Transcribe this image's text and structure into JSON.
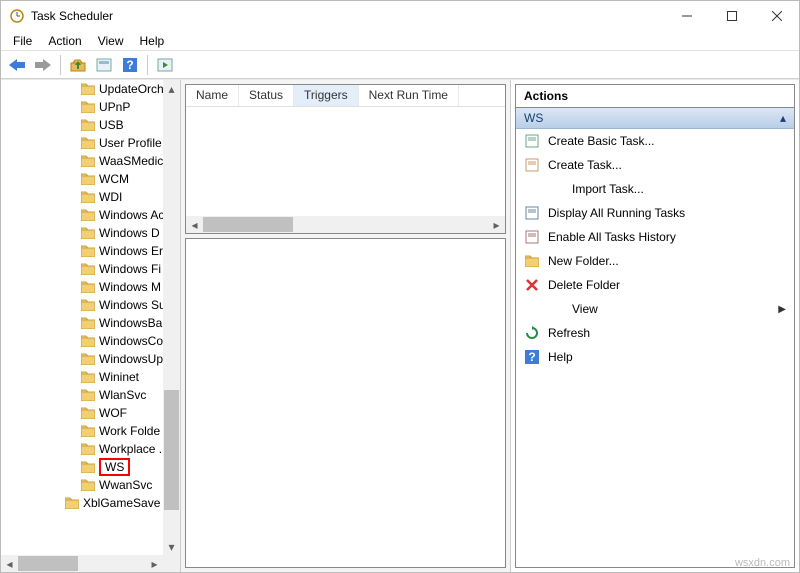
{
  "window": {
    "title": "Task Scheduler"
  },
  "menubar": [
    "File",
    "Action",
    "View",
    "Help"
  ],
  "tree": [
    {
      "label": "UpdateOrch",
      "level": 1
    },
    {
      "label": "UPnP",
      "level": 1
    },
    {
      "label": "USB",
      "level": 1
    },
    {
      "label": "User Profile",
      "level": 1
    },
    {
      "label": "WaaSMedic",
      "level": 1
    },
    {
      "label": "WCM",
      "level": 1
    },
    {
      "label": "WDI",
      "level": 1
    },
    {
      "label": "Windows Ac",
      "level": 1
    },
    {
      "label": "Windows D",
      "level": 1
    },
    {
      "label": "Windows Er",
      "level": 1
    },
    {
      "label": "Windows Fi",
      "level": 1
    },
    {
      "label": "Windows M",
      "level": 1
    },
    {
      "label": "Windows Su",
      "level": 1
    },
    {
      "label": "WindowsBa",
      "level": 1
    },
    {
      "label": "WindowsCo",
      "level": 1
    },
    {
      "label": "WindowsUp",
      "level": 1
    },
    {
      "label": "Wininet",
      "level": 1
    },
    {
      "label": "WlanSvc",
      "level": 1
    },
    {
      "label": "WOF",
      "level": 1
    },
    {
      "label": "Work Folde",
      "level": 1
    },
    {
      "label": "Workplace .",
      "level": 1
    },
    {
      "label": "WS",
      "level": 1,
      "selected": true
    },
    {
      "label": "WwanSvc",
      "level": 1
    },
    {
      "label": "XblGameSave",
      "level": 2
    }
  ],
  "columns": [
    {
      "label": "Name",
      "selected": false
    },
    {
      "label": "Status",
      "selected": false
    },
    {
      "label": "Triggers",
      "selected": true
    },
    {
      "label": "Next Run Time",
      "selected": false
    }
  ],
  "actions": {
    "header": "Actions",
    "section": "WS",
    "items": [
      {
        "icon": "create-basic-icon",
        "label": "Create Basic Task...",
        "color": "#6a8"
      },
      {
        "icon": "create-task-icon",
        "label": "Create Task...",
        "color": "#c96"
      },
      {
        "icon": "import-icon",
        "label": "Import Task...",
        "indent": true
      },
      {
        "icon": "display-running-icon",
        "label": "Display All Running Tasks",
        "color": "#68a"
      },
      {
        "icon": "enable-history-icon",
        "label": "Enable All Tasks History",
        "color": "#a77"
      },
      {
        "icon": "new-folder-icon",
        "label": "New Folder...",
        "color": "#e9b95a"
      },
      {
        "icon": "delete-folder-icon",
        "label": "Delete Folder",
        "color": "#d33",
        "bold": true
      },
      {
        "icon": "view-icon",
        "label": "View",
        "indent": true,
        "submenu": true
      },
      {
        "icon": "refresh-icon",
        "label": "Refresh",
        "color": "#2a8"
      },
      {
        "icon": "help-icon",
        "label": "Help",
        "color": "#36c"
      }
    ]
  },
  "watermark": "wsxdn.com"
}
